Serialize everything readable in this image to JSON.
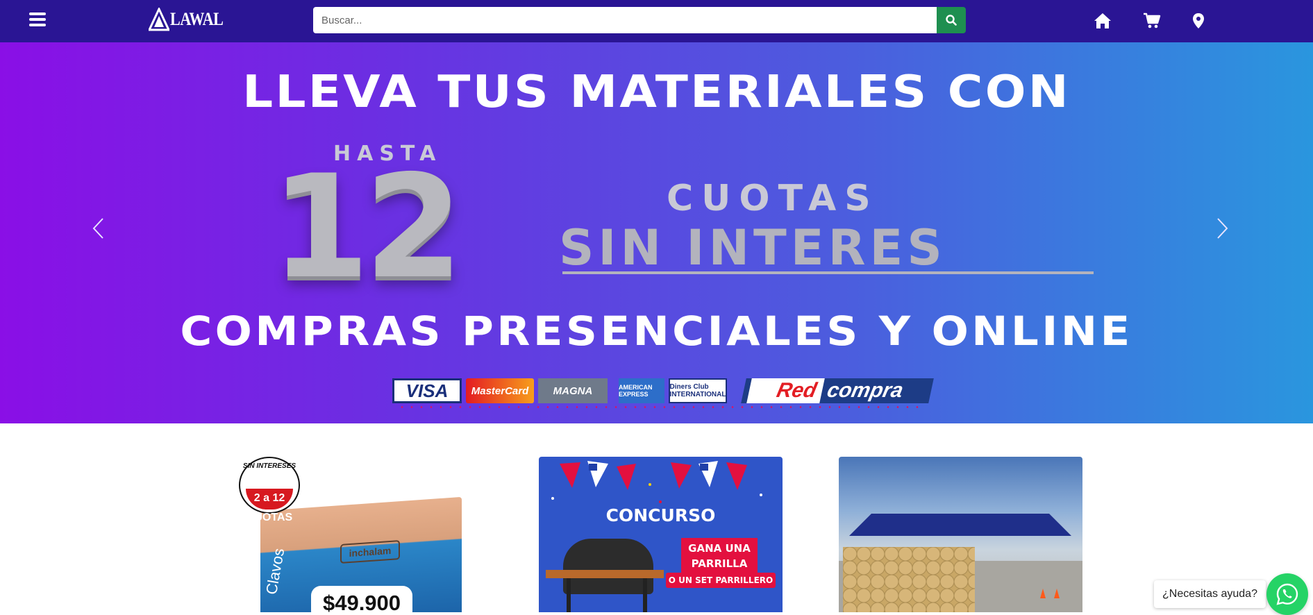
{
  "header": {
    "brand": "LAWAL",
    "search_placeholder": "Buscar...",
    "colors": {
      "bar": "#2a1594",
      "search_button": "#1e8f50"
    },
    "icons": [
      "menu-icon",
      "search-icon",
      "home-icon",
      "cart-icon",
      "location-pin-icon"
    ]
  },
  "hero": {
    "line1": "LLEVA TUS MATERIALES CON",
    "hasta": "HASTA",
    "number": "12",
    "cuotas": "CUOTAS",
    "sin_intereses": "SIN INTERES",
    "line3": "COMPRAS PRESENCIALES Y ONLINE",
    "payment_cards": {
      "visa": "VISA",
      "mastercard": "MasterCard",
      "magna": "MAGNA",
      "amex": "AMERICAN EXPRESS",
      "diners": "Diners Club INTERNATIONAL",
      "red": "Red",
      "compra": "compra"
    },
    "prev_icon": "chevron-left-icon",
    "next_icon": "chevron-right-icon"
  },
  "tiles": {
    "promo1": {
      "badge_top": "SIN INTERESES",
      "badge_bottom": "2 a 12 CUOTAS",
      "brand": "inchalam",
      "product": "Clavos",
      "price": "$49.900"
    },
    "promo2": {
      "title": "CONCURSO",
      "prize": "GANA UNA PARRILLA",
      "alt_prize": "O UN SET PARRILLERO"
    },
    "promo3": {}
  },
  "help": {
    "label": "¿Necesitas ayuda?",
    "icon": "whatsapp-icon",
    "color": "#25d366"
  }
}
